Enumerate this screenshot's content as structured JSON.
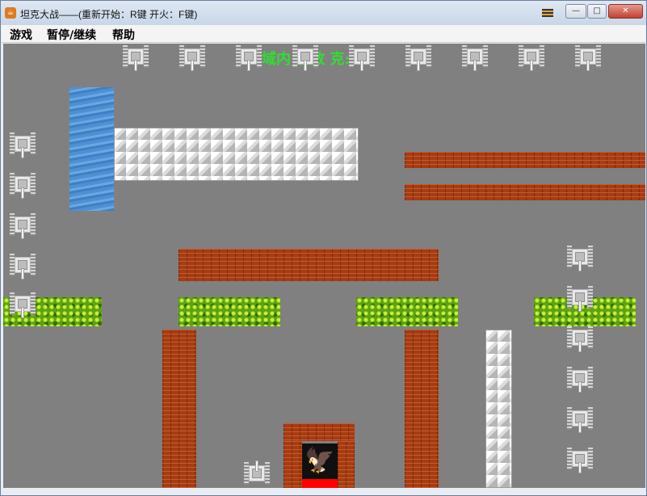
{
  "window": {
    "title": "坦克大战——(重新开始：R键  开火：F键)",
    "java_icon": "☕",
    "controls": {
      "minimize": "—",
      "maximize": "□",
      "close": "✕"
    }
  },
  "menu": [
    "游戏",
    "暂停/继续",
    "帮助"
  ],
  "hud": {
    "text": "域内   有敌    克:"
  },
  "colors": {
    "field": "#808080",
    "brick": "#a53c12",
    "grass": "#5ea20f",
    "water": "#4f90d4",
    "hud": "#2ee02e",
    "base_flag": "#ff0000"
  },
  "icons": {
    "base": "eagle-icon",
    "player": "player-tank-icon",
    "enemy": "enemy-tank-icon"
  }
}
